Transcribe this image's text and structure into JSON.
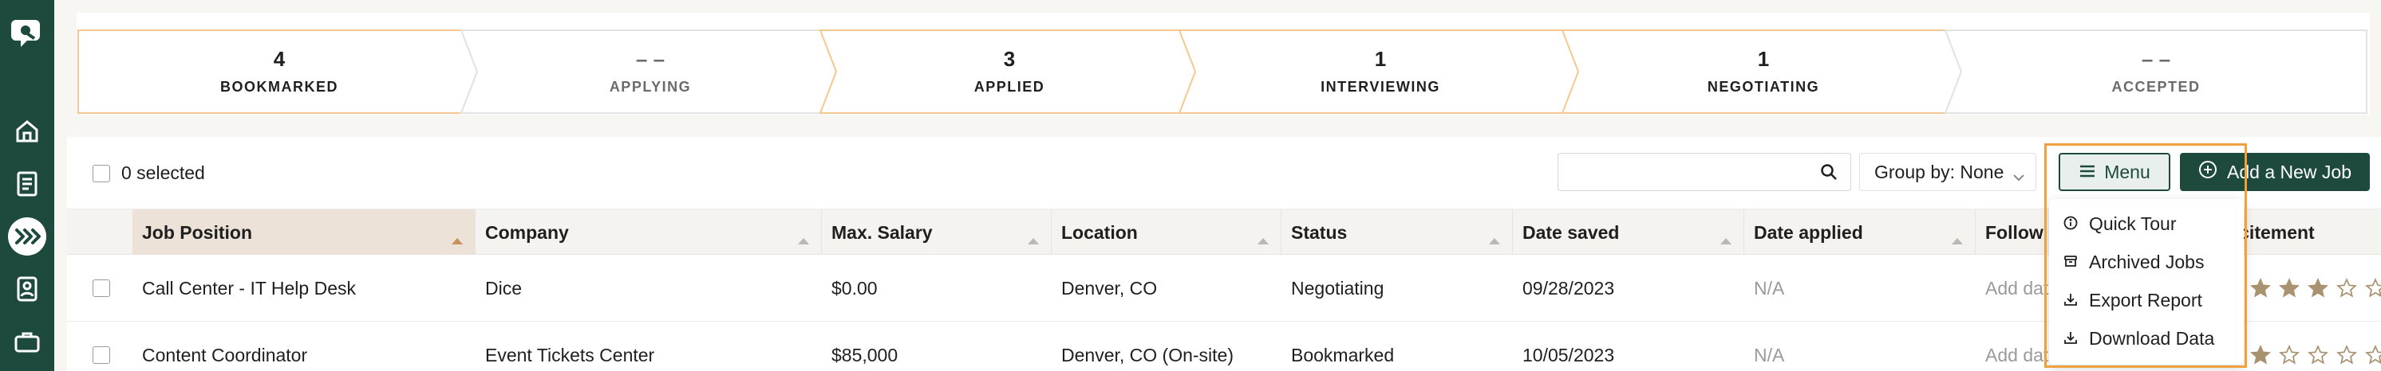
{
  "sidebar": {
    "items": [
      {
        "name": "logo",
        "icon": "app-logo-icon"
      },
      {
        "name": "home",
        "icon": "home-icon"
      },
      {
        "name": "documents",
        "icon": "document-icon"
      },
      {
        "name": "job-tracker",
        "icon": "double-chevron-right-icon",
        "active": true
      },
      {
        "name": "contacts",
        "icon": "contact-card-icon"
      },
      {
        "name": "jobs",
        "icon": "briefcase-icon"
      }
    ]
  },
  "pipeline": {
    "stages": [
      {
        "count": "4",
        "label": "BOOKMARKED",
        "dim": false
      },
      {
        "count": "– –",
        "label": "APPLYING",
        "dim": true
      },
      {
        "count": "3",
        "label": "APPLIED",
        "dim": false
      },
      {
        "count": "1",
        "label": "INTERVIEWING",
        "dim": false
      },
      {
        "count": "1",
        "label": "NEGOTIATING",
        "dim": false
      },
      {
        "count": "– –",
        "label": "ACCEPTED",
        "dim": true
      }
    ]
  },
  "toolbar": {
    "selected_text": "0 selected",
    "search_placeholder": "",
    "group_by": "Group by: None",
    "menu_label": "Menu",
    "add_label": "Add a New Job"
  },
  "table": {
    "columns": [
      "Job Position",
      "Company",
      "Max. Salary",
      "Location",
      "Status",
      "Date saved",
      "Date applied",
      "Follow up",
      "Excitement"
    ],
    "rows": [
      {
        "position": "Call Center - IT Help Desk",
        "company": "Dice",
        "salary": "$0.00",
        "location": "Denver, CO",
        "status": "Negotiating",
        "date_saved": "09/28/2023",
        "date_applied": "N/A",
        "follow_up": "Add date",
        "excitement": 3
      },
      {
        "position": "Content Coordinator",
        "company": "Event Tickets Center",
        "salary": "$85,000",
        "location": "Denver, CO (On-site)",
        "status": "Bookmarked",
        "date_saved": "10/05/2023",
        "date_applied": "N/A",
        "follow_up": "Add date",
        "excitement": 1
      }
    ]
  },
  "menu_dropdown": {
    "items": [
      {
        "label": "Quick Tour",
        "icon": "info-icon"
      },
      {
        "label": "Archived Jobs",
        "icon": "archive-icon"
      },
      {
        "label": "Export Report",
        "icon": "download-icon"
      },
      {
        "label": "Download Data",
        "icon": "download-icon"
      }
    ]
  },
  "colors": {
    "brand": "#1e4a3d",
    "accent": "#f2a03d",
    "star": "#a8926f",
    "active_header": "#ece2d8"
  }
}
